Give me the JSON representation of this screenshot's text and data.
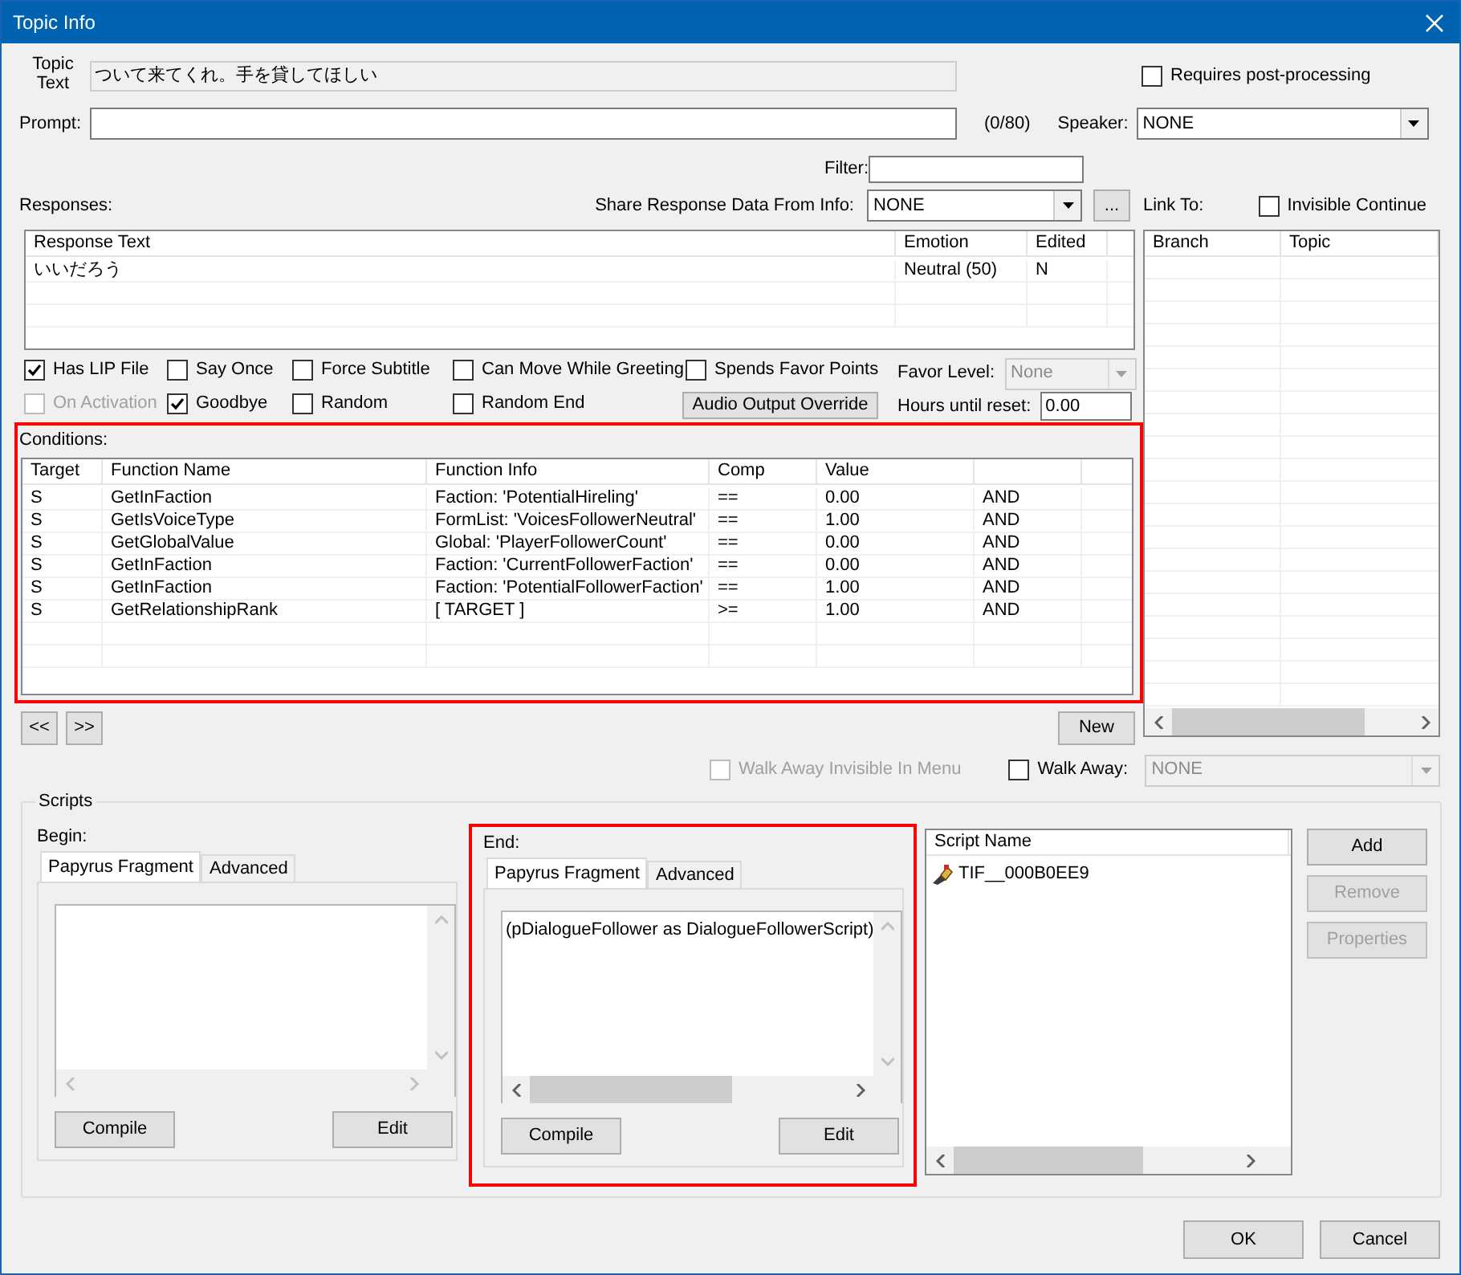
{
  "window": {
    "title": "Topic Info"
  },
  "topic_text": {
    "label": "Topic Text",
    "value": "ついて来てくれ。手を貸してほしい"
  },
  "requires_post_processing": {
    "label": "Requires post-processing",
    "checked": false
  },
  "prompt": {
    "label": "Prompt:",
    "count": "(0/80)"
  },
  "speaker": {
    "label": "Speaker:",
    "value": "NONE"
  },
  "filter": {
    "label": "Filter:"
  },
  "responses": {
    "label": "Responses:",
    "columns": [
      "Response Text",
      "Emotion",
      "Edited"
    ],
    "rows": [
      [
        "いいだろう",
        "Neutral (50)",
        "N"
      ]
    ]
  },
  "share_response": {
    "label": "Share Response Data From Info:",
    "value": "NONE",
    "button": "..."
  },
  "link_to": {
    "label": "Link To:",
    "invisible_continue": {
      "label": "Invisible Continue",
      "checked": false
    },
    "columns": [
      "Branch",
      "Topic"
    ]
  },
  "flags": [
    {
      "label": "Has LIP File",
      "checked": true,
      "disabled": false
    },
    {
      "label": "Say Once",
      "checked": false,
      "disabled": false
    },
    {
      "label": "Force Subtitle",
      "checked": false,
      "disabled": false
    },
    {
      "label": "Can Move While Greeting",
      "checked": false,
      "disabled": false
    },
    {
      "label": "Spends Favor Points",
      "checked": false,
      "disabled": false
    },
    {
      "label": "On Activation",
      "checked": false,
      "disabled": true
    },
    {
      "label": "Goodbye",
      "checked": true,
      "disabled": false
    },
    {
      "label": "Random",
      "checked": false,
      "disabled": false
    },
    {
      "label": "Random End",
      "checked": false,
      "disabled": false
    }
  ],
  "audio_output_override": "Audio Output Override",
  "favor_level": {
    "label": "Favor Level:",
    "value": "None",
    "disabled": true
  },
  "hours_until_reset": {
    "label": "Hours until reset:",
    "value": "0.00"
  },
  "conditions": {
    "label": "Conditions:",
    "highlighted": true,
    "columns": [
      "Target",
      "Function Name",
      "Function Info",
      "Comp",
      "Value"
    ],
    "rows": [
      [
        "S",
        "GetInFaction",
        "Faction: 'PotentialHireling'",
        "==",
        "0.00",
        "AND"
      ],
      [
        "S",
        "GetIsVoiceType",
        "FormList: 'VoicesFollowerNeutral'",
        "==",
        "1.00",
        "AND"
      ],
      [
        "S",
        "GetGlobalValue",
        "Global: 'PlayerFollowerCount'",
        "==",
        "0.00",
        "AND"
      ],
      [
        "S",
        "GetInFaction",
        "Faction: 'CurrentFollowerFaction'",
        "==",
        "0.00",
        "AND"
      ],
      [
        "S",
        "GetInFaction",
        "Faction: 'PotentialFollowerFaction'",
        "==",
        "1.00",
        "AND"
      ],
      [
        "S",
        "GetRelationshipRank",
        "[ TARGET ]",
        ">=",
        "1.00",
        "AND"
      ]
    ]
  },
  "nav_buttons": [
    "<<",
    ">>"
  ],
  "new_button": "New",
  "walk_away_invisible": {
    "label": "Walk Away Invisible In Menu",
    "checked": false,
    "disabled": true
  },
  "walk_away": {
    "label": "Walk Away:",
    "checked": false,
    "value": "NONE",
    "disabled": true
  },
  "scripts": {
    "label": "Scripts",
    "panels": [
      {
        "label": "Begin:",
        "highlighted": false,
        "tabs": [
          {
            "label": "Papyrus Fragment",
            "selected": true
          },
          {
            "label": "Advanced",
            "selected": false
          }
        ],
        "buttons": [
          "Compile",
          "Edit"
        ]
      },
      {
        "label": "End:",
        "highlighted": true,
        "tabs": [
          {
            "label": "Papyrus Fragment",
            "selected": true
          },
          {
            "label": "Advanced",
            "selected": false
          }
        ],
        "code": "(pDialogueFollower as DialogueFollowerScript)",
        "buttons": [
          "Compile",
          "Edit"
        ]
      }
    ],
    "script_list": {
      "column": "Script Name",
      "items": [
        "TIF__000B0EE9"
      ]
    },
    "buttons": [
      {
        "label": "Add",
        "disabled": false
      },
      {
        "label": "Remove",
        "disabled": true
      },
      {
        "label": "Properties",
        "disabled": true
      }
    ]
  },
  "dialog_buttons": [
    "OK",
    "Cancel"
  ]
}
